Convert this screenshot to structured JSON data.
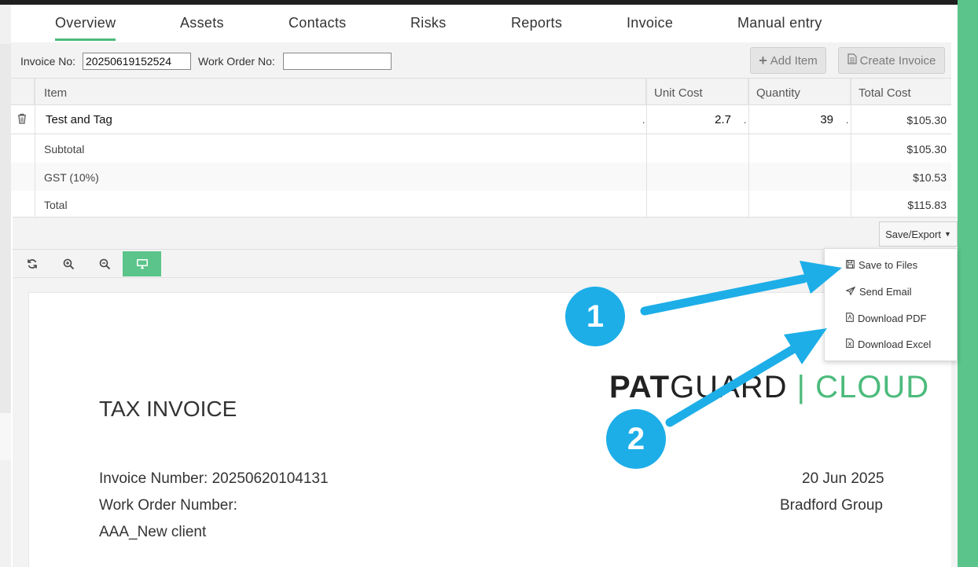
{
  "tabs": [
    {
      "label": "Overview",
      "active": true
    },
    {
      "label": "Assets"
    },
    {
      "label": "Contacts"
    },
    {
      "label": "Risks"
    },
    {
      "label": "Reports"
    },
    {
      "label": "Invoice"
    },
    {
      "label": "Manual entry"
    }
  ],
  "invoice_form": {
    "invoice_no_label": "Invoice No:",
    "invoice_no_value": "20250619152524",
    "work_order_label": "Work Order No:",
    "work_order_value": "",
    "add_item_label": "Add Item",
    "create_invoice_label": "Create Invoice"
  },
  "table": {
    "headers": [
      "Item",
      "Unit Cost",
      "Quantity",
      "Total Cost"
    ],
    "rows": [
      {
        "item": "Test and Tag",
        "unit_cost": "2.7",
        "quantity": "39",
        "total": "$105.30"
      }
    ],
    "summary": [
      {
        "label": "Subtotal",
        "value": "$105.30"
      },
      {
        "label": "GST (10%)",
        "value": "$10.53"
      },
      {
        "label": "Total",
        "value": "$115.83"
      }
    ]
  },
  "export": {
    "button_label": "Save/Export",
    "menu": [
      "Save to Files",
      "Send Email",
      "Download PDF",
      "Download Excel"
    ]
  },
  "document": {
    "logo_left": "PAT",
    "logo_mid": "GUARD",
    "logo_sep": "|",
    "logo_right": "CLOUD",
    "title": "TAX INVOICE",
    "invoice_number": "Invoice Number: 20250620104131",
    "work_order_number": "Work Order Number:",
    "client": "AAA_New client",
    "date": "20 Jun 2025",
    "company": "Bradford Group"
  },
  "annotations": [
    "1",
    "2"
  ],
  "colors": {
    "accent_green": "#5ac48a",
    "callout_blue": "#1daee8"
  }
}
